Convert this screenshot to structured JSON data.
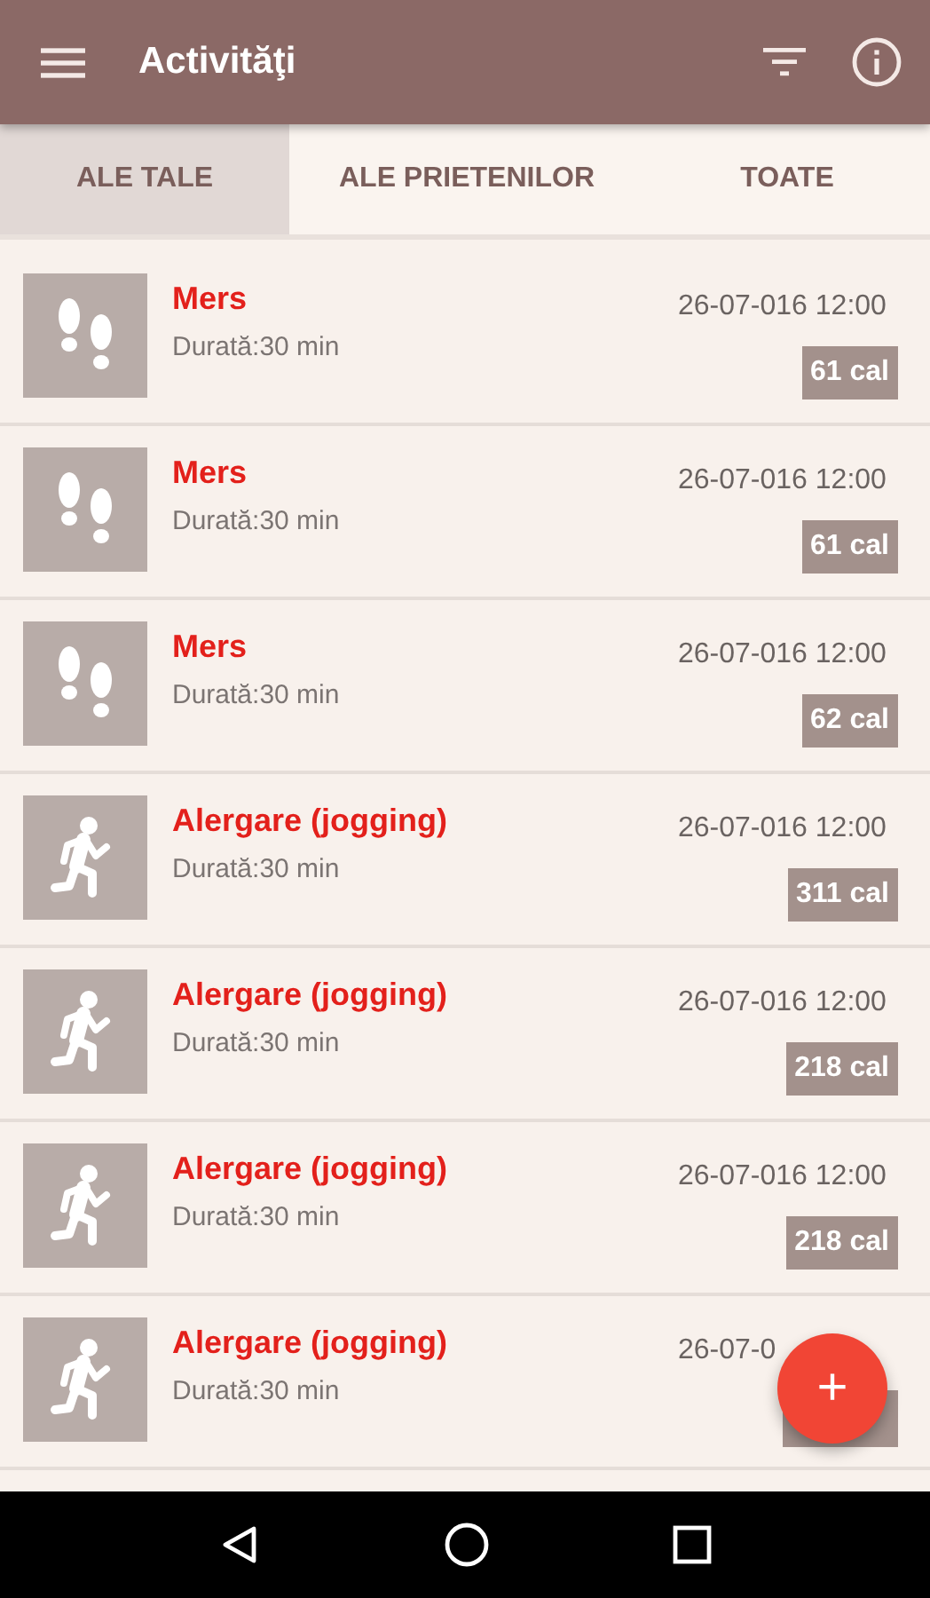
{
  "app_bar": {
    "title": "Activităţi"
  },
  "tabs": [
    {
      "label": "ALE TALE",
      "selected": true
    },
    {
      "label": "ALE PRIETENILOR",
      "selected": false
    },
    {
      "label": "TOATE",
      "selected": false
    }
  ],
  "activities": [
    {
      "kind": "walk",
      "name": "Mers",
      "duration": "Durată:30 min",
      "date": "26-07-016 12:00",
      "calories": "61 cal"
    },
    {
      "kind": "walk",
      "name": "Mers",
      "duration": "Durată:30 min",
      "date": "26-07-016 12:00",
      "calories": "61 cal"
    },
    {
      "kind": "walk",
      "name": "Mers",
      "duration": "Durată:30 min",
      "date": "26-07-016 12:00",
      "calories": "62 cal"
    },
    {
      "kind": "run",
      "name": "Alergare (jogging)",
      "duration": "Durată:30 min",
      "date": "26-07-016 12:00",
      "calories": "311 cal"
    },
    {
      "kind": "run",
      "name": "Alergare (jogging)",
      "duration": "Durată:30 min",
      "date": "26-07-016 12:00",
      "calories": "218 cal"
    },
    {
      "kind": "run",
      "name": "Alergare (jogging)",
      "duration": "Durată:30 min",
      "date": "26-07-016 12:00",
      "calories": "218 cal"
    },
    {
      "kind": "run",
      "name": "Alergare (jogging)",
      "duration": "Durată:30 min",
      "date": "26-07-0"
    }
  ],
  "fab": {
    "label": "+"
  }
}
